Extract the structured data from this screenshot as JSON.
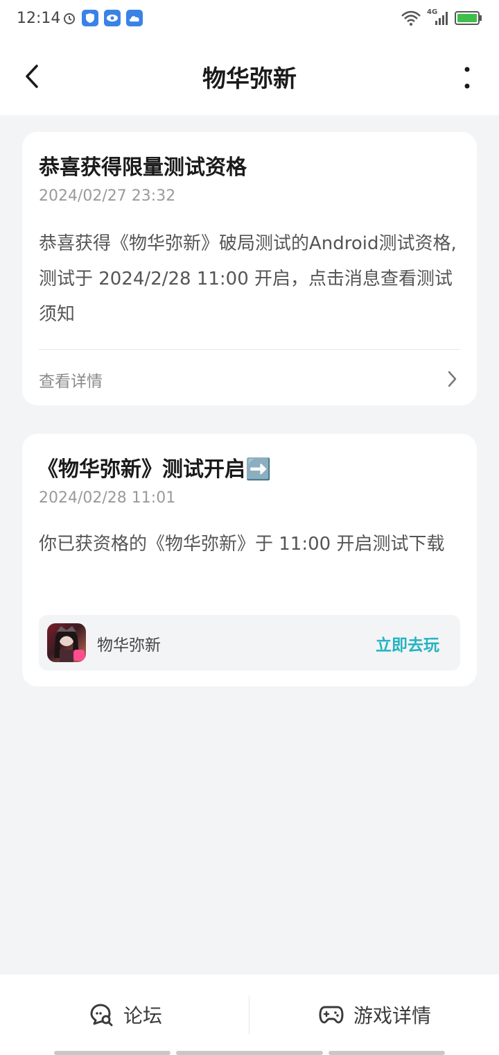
{
  "status_bar": {
    "time": "12:14",
    "network": "4G"
  },
  "header": {
    "title": "物华弥新"
  },
  "messages": [
    {
      "title": "恭喜获得限量测试资格",
      "time": "2024/02/27 23:32",
      "body": "恭喜获得《物华弥新》破局测试的Android测试资格,测试于 2024/2/28 11:00 开启，点击消息查看测试须知",
      "link_label": "查看详情"
    },
    {
      "title": "《物华弥新》测试开启➡️",
      "time": "2024/02/28 11:01",
      "body": "你已获资格的《物华弥新》于 11:00 开启测试下载",
      "game_name": "物华弥新",
      "play_label": "立即去玩"
    }
  ],
  "bottom_bar": {
    "forum_label": "论坛",
    "game_detail_label": "游戏详情"
  },
  "colors": {
    "accent": "#23b3c1",
    "background": "#f3f4f6"
  }
}
